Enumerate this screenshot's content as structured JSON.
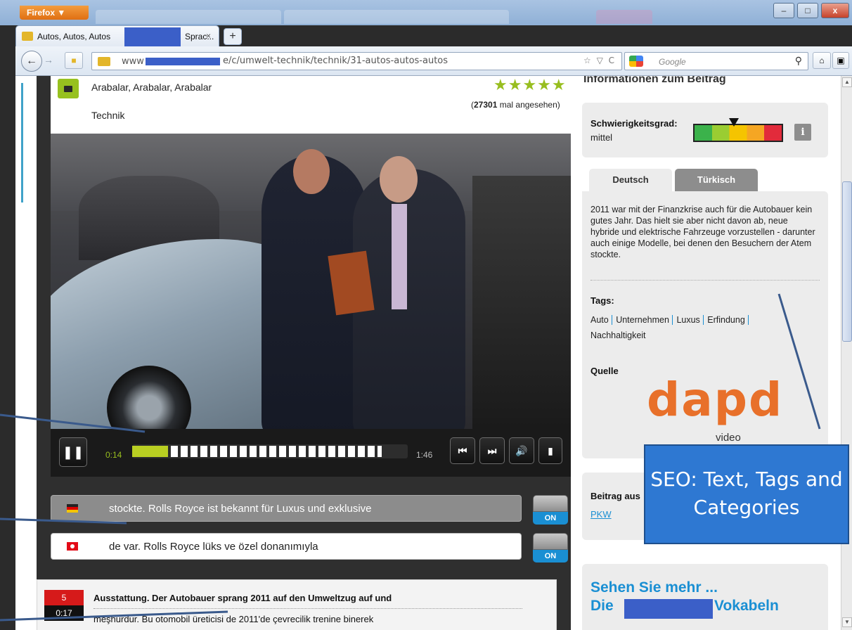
{
  "browser": {
    "menu_label": "Firefox ▼",
    "tab_title_left": "Autos, Autos, Autos",
    "tab_title_right": "Sprac...",
    "tab_close": "×",
    "new_tab": "+",
    "url_prefix": "www",
    "url_path": "e/c/umwelt-technik/technik/31-autos-autos-autos",
    "url_extras": "☆ ▽ C",
    "search_placeholder": "Google",
    "window_minimize": "–",
    "window_maximize": "□",
    "window_close": "x"
  },
  "video_header": {
    "title": "Arabalar, Arabalar, Arabalar",
    "category": "Technik",
    "rating_stars": "★★★★★",
    "views_count": "27301",
    "views_suffix": "mal angesehen"
  },
  "player": {
    "current_time": "0:14",
    "duration": "1:46",
    "progress_fraction": 0.13
  },
  "subtitles": {
    "german": "stockte. Rolls Royce ist bekannt für Luxus und exklusive",
    "turkish": "de var. Rolls Royce lüks ve özel donanımıyla",
    "toggle_label": "ON"
  },
  "word_list": {
    "number": "5",
    "time": "0:17",
    "german": "Ausstattung. Der Autobauer sprang 2011 auf den Umweltzug auf und",
    "turkish": "meşhurdur. Bu otomobil üreticisi de 2011'de çevrecilik trenine binerek"
  },
  "sidebar": {
    "heading": "Informationen zum Beitrag",
    "difficulty_label": "Schwierigkeitsgrad:",
    "difficulty_value": "mittel",
    "difficulty_level": 0.45,
    "info_label": "i",
    "tab_german": "Deutsch",
    "tab_turkish": "Türkisch",
    "description": "2011 war mit der Finanzkrise auch für die Autobauer kein gutes Jahr. Das hielt sie aber nicht davon ab, neue hybride und elektrische Fahrzeuge vorzustellen - darunter auch einige Modelle, bei denen den Besuchern der Atem stockte.",
    "tags_heading": "Tags:",
    "tags": [
      "Auto",
      "Unternehmen",
      "Luxus",
      "Erfindung",
      "Nachhaltigkeit"
    ],
    "source_heading": "Quelle",
    "source_logo": "dapd",
    "source_logo_sub": "video",
    "category_heading": "Beitrag aus",
    "category_link": "PKW",
    "more_line1": "Sehen Sie mehr ...",
    "more_line2_start": "Die",
    "more_line2_end": "Vokabeln"
  },
  "annotation": {
    "callout_text": "SEO: Text, Tags and Categories"
  },
  "colors": {
    "accent_green": "#98be1f",
    "link_blue": "#1a8fd3",
    "callout_blue": "#2e78d2",
    "dapd_orange": "#e8702a",
    "annotation_line": "#3a5a8c"
  }
}
